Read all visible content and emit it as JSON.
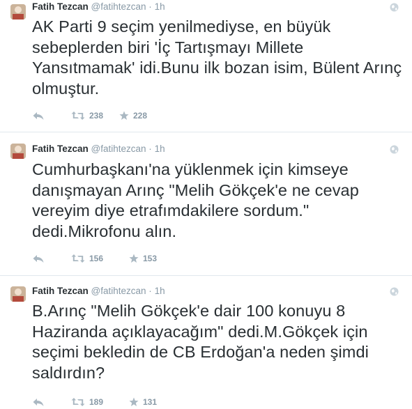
{
  "colors": {
    "name": "#292f33",
    "meta": "#8899a6",
    "icon": "#aab8c2",
    "divider": "#e1e8ed"
  },
  "tweets": [
    {
      "author": "Fatih Tezcan",
      "handle": "@fatihtezcan",
      "dot": "·",
      "time": "1h",
      "text": "AK Parti 9 seçim yenilmediyse, en büyük sebeplerden biri 'İç Tartışmayı Millete Yansıtmamak' idi.Bunu ilk bozan isim, Bülent Arınç olmuştur.",
      "retweets": "238",
      "favorites": "228"
    },
    {
      "author": "Fatih Tezcan",
      "handle": "@fatihtezcan",
      "dot": "·",
      "time": "1h",
      "text": "Cumhurbaşkanı'na yüklenmek için kimseye danışmayan Arınç \"Melih Gökçek'e ne cevap vereyim diye etrafımdakilere sordum.\" dedi.Mikrofonu alın.",
      "retweets": "156",
      "favorites": "153"
    },
    {
      "author": "Fatih Tezcan",
      "handle": "@fatihtezcan",
      "dot": "·",
      "time": "1h",
      "text": "B.Arınç \"Melih Gökçek'e dair 100 konuyu 8 Haziranda açıklayacağım\" dedi.M.Gökçek için seçimi bekledin de CB Erdoğan'a neden şimdi saldırdın?",
      "retweets": "189",
      "favorites": "131"
    }
  ]
}
